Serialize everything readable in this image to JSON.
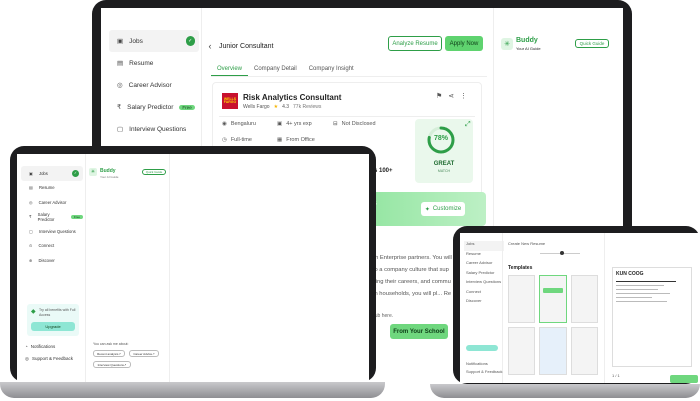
{
  "back_laptop": {
    "sidebar": {
      "items": [
        {
          "label": "Jobs",
          "icon": "briefcase-icon",
          "active": true
        },
        {
          "label": "Resume",
          "icon": "document-icon"
        },
        {
          "label": "Career Advisor",
          "icon": "compass-icon"
        },
        {
          "label": "Salary Predictor",
          "icon": "rupee-icon",
          "badge": "Free"
        },
        {
          "label": "Interview Questions",
          "icon": "chat-icon"
        }
      ]
    },
    "header": {
      "title": "Junior Consultant",
      "analyze_label": "Analyze Resume",
      "apply_label": "Apply Now"
    },
    "tabs": [
      "Overview",
      "Company Detail",
      "Company Insight"
    ],
    "job": {
      "logo_text": "WELLS FARGO",
      "title": "Risk Analytics Consultant",
      "company": "Wells Fargo",
      "rating": "4.3",
      "reviews": "77k Reviews",
      "location": "Bengaluru",
      "experience": "4+ yrs exp",
      "salary": "Not Disclosed",
      "employment": "Full-time",
      "workplace": "From Office",
      "match_percent": "78%",
      "match_value": 0.78,
      "match_label": "GREAT",
      "match_sub": "MATCH",
      "applicants": "ants 100+",
      "customize_label": "Customize",
      "banner_fragment": "es",
      "description_lines": [
        "with Enterprise partners. You will",
        "g to a company culture that sup",
        "loping their careers, and commu",
        "ean households, you will pl... Re"
      ],
      "fragment_footer": "dub here.",
      "from_school": "From Your School"
    },
    "buddy": {
      "title": "Buddy",
      "subtitle": "Your AI Guide",
      "quick_guide": "Quick Guide"
    }
  },
  "left_laptop": {
    "sidebar": {
      "items": [
        {
          "label": "Jobs",
          "icon": "briefcase-icon",
          "active": true
        },
        {
          "label": "Resume",
          "icon": "document-icon"
        },
        {
          "label": "Career Advisor",
          "icon": "compass-icon"
        },
        {
          "label": "Salary Predictor",
          "icon": "rupee-icon",
          "badge": "Free"
        },
        {
          "label": "Interview Questions",
          "icon": "chat-icon"
        },
        {
          "label": "Connect",
          "icon": "link-icon"
        },
        {
          "label": "Discover",
          "icon": "globe-icon"
        }
      ]
    },
    "upgrade_text": "Try all benefits with Full Access",
    "upgrade_label": "Upgrade",
    "notifications_label": "Notifications",
    "support_label": "Support & Feedback",
    "buddy": {
      "title": "Buddy",
      "subtitle": "Your AI Guide",
      "quick_guide": "Quick Guide"
    },
    "ask_text": "You can ask me about:",
    "suggestions": [
      "Recent analysis",
      "Career Advice",
      "Interview Questions"
    ]
  },
  "right_laptop": {
    "sidebar": {
      "items": [
        "Jobs",
        "Resume",
        "Career Advisor",
        "Salary Predictor",
        "Interview Questions",
        "Connect",
        "Discover"
      ]
    },
    "notifications_label": "Notifications",
    "support_label": "Support & Feedback",
    "header_title": "Create New Resume",
    "templates_heading": "Templates",
    "resume_name": "KUN COOG",
    "page_indicator": "1 / 1"
  }
}
